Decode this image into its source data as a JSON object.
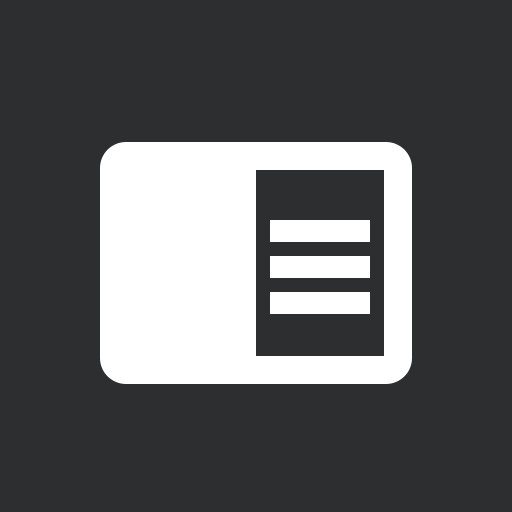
{
  "icon": {
    "name": "sidebar-panel-icon",
    "background_color": "#2d2e30",
    "foreground_color": "#ffffff",
    "panel_color": "#2d2e30",
    "menu_line_count": 3
  }
}
